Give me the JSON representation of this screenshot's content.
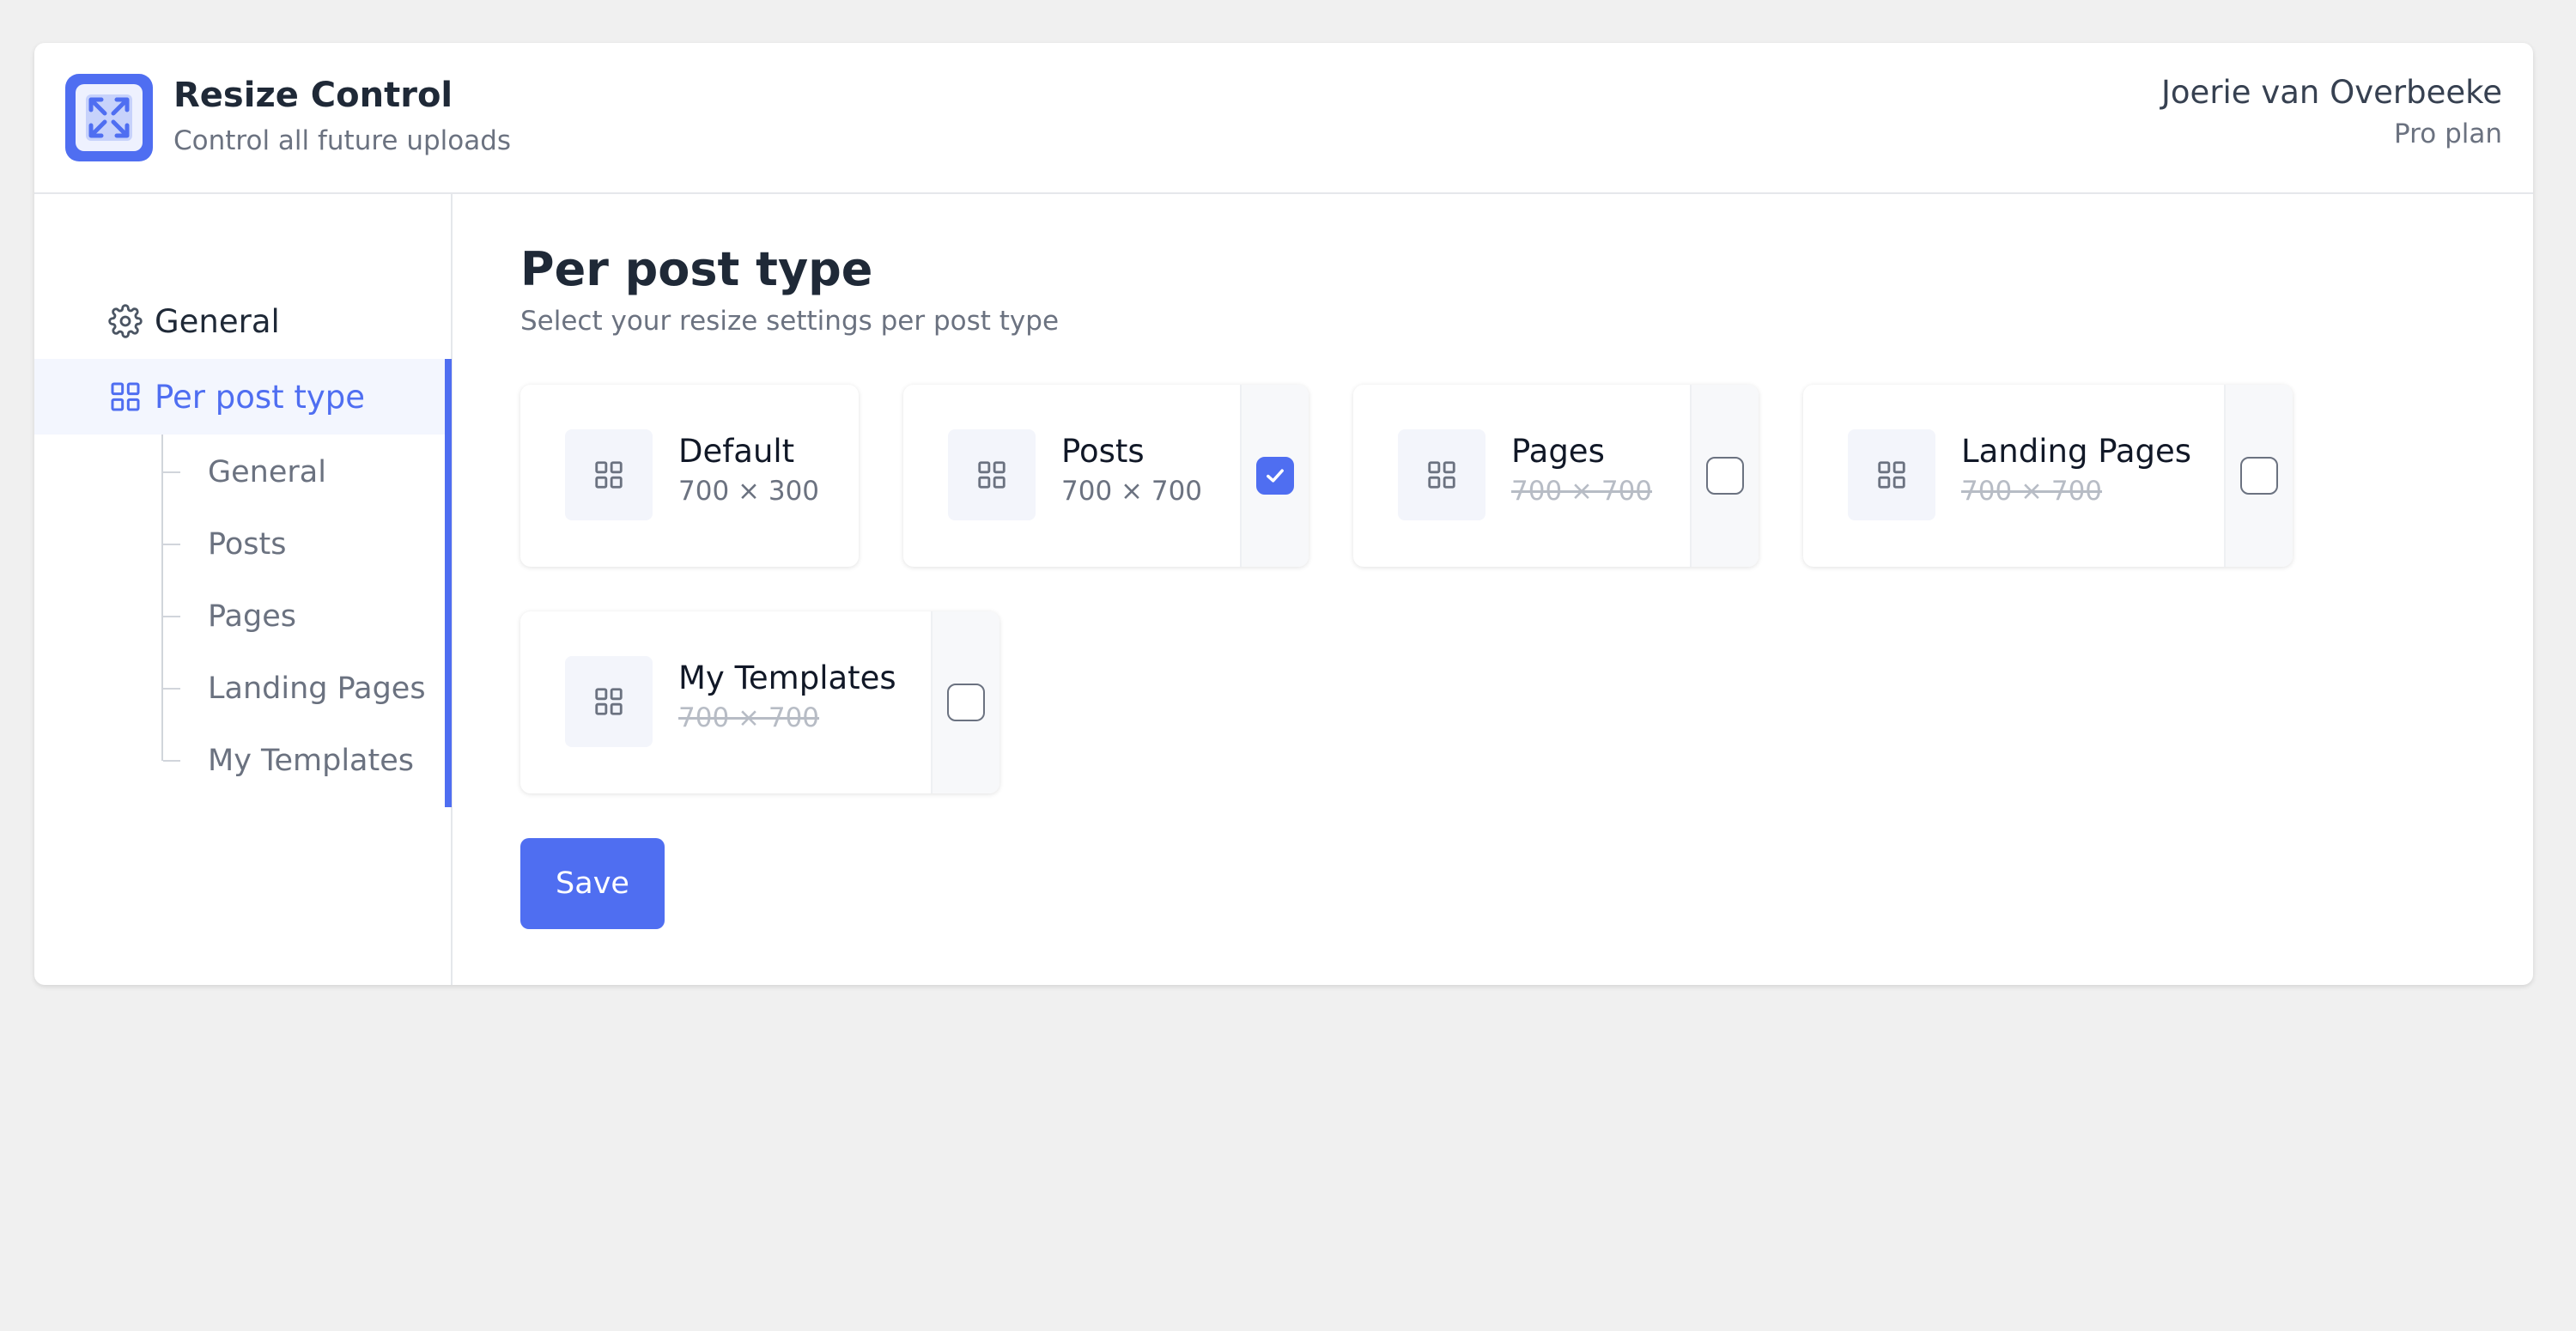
{
  "header": {
    "app_title": "Resize Control",
    "app_subtitle": "Control all future uploads",
    "user_name": "Joerie van Overbeeke",
    "user_plan": "Pro plan"
  },
  "sidebar": {
    "items": [
      {
        "label": "General",
        "icon": "gear-icon",
        "active": false
      },
      {
        "label": "Per post type",
        "icon": "grid-icon",
        "active": true
      }
    ],
    "sub_items": [
      "General",
      "Posts",
      "Pages",
      "Landing Pages",
      "My Templates"
    ]
  },
  "main": {
    "title": "Per post type",
    "subtitle": "Select your resize settings per post type",
    "cards": [
      {
        "name": "Default",
        "size": "700 × 300",
        "has_checkbox": false,
        "checked": null
      },
      {
        "name": "Posts",
        "size": "700 × 700",
        "has_checkbox": true,
        "checked": true
      },
      {
        "name": "Pages",
        "size": "700 × 700",
        "has_checkbox": true,
        "checked": false
      },
      {
        "name": "Landing Pages",
        "size": "700 × 700",
        "has_checkbox": true,
        "checked": false
      },
      {
        "name": "My Templates",
        "size": "700 × 700",
        "has_checkbox": true,
        "checked": false
      }
    ],
    "save_label": "Save"
  },
  "colors": {
    "accent": "#4f6ef1",
    "background": "#f0f0f0",
    "text": "#1f2937",
    "muted": "#6b7280"
  }
}
